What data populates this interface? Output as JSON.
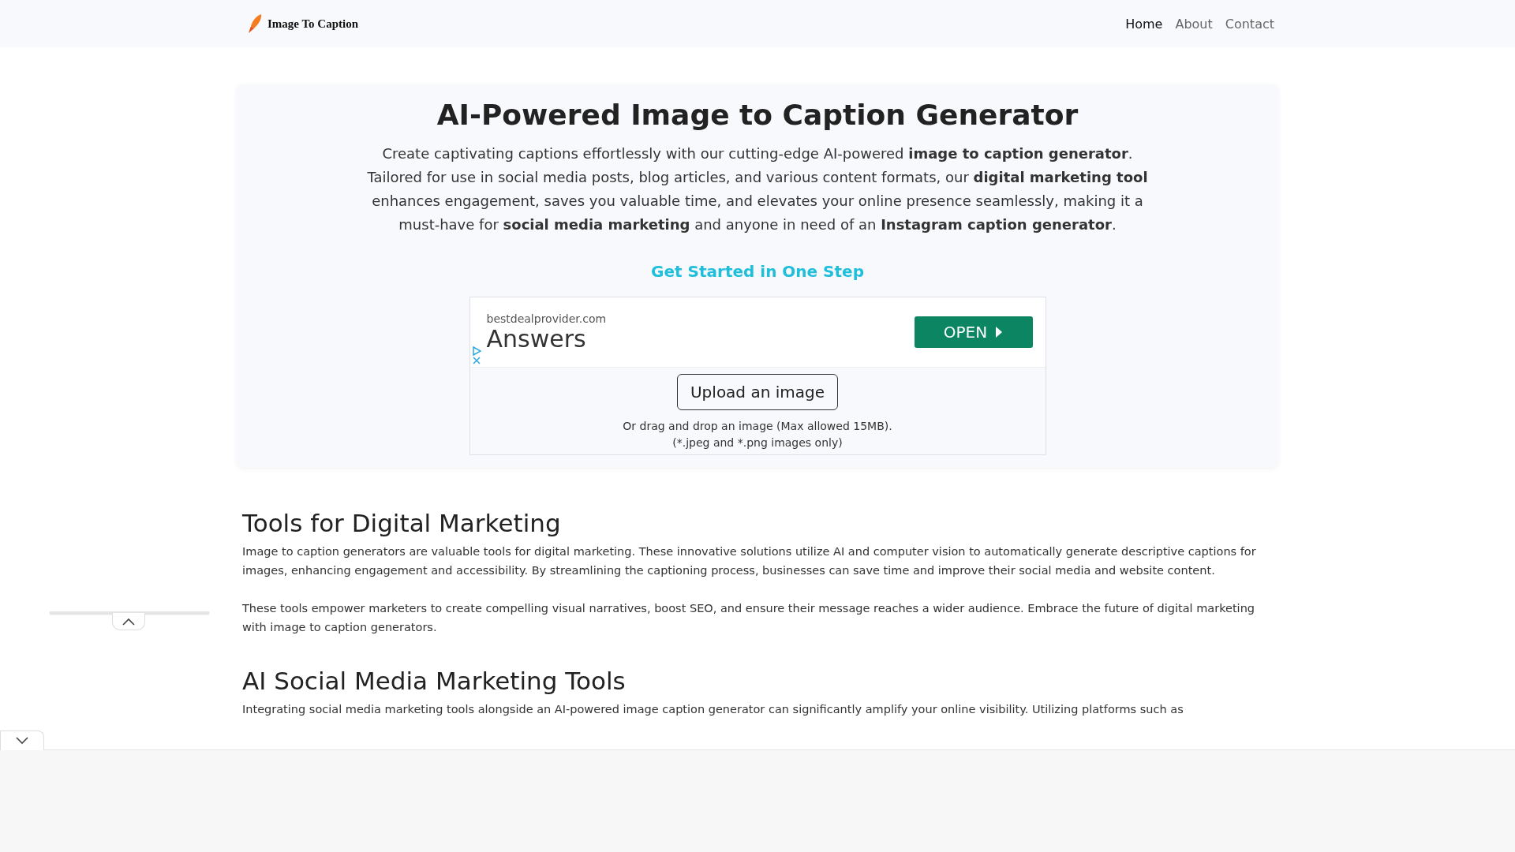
{
  "header": {
    "logo_text": "Image To Caption",
    "nav": [
      {
        "label": "Home",
        "selected": true
      },
      {
        "label": "About",
        "selected": false
      },
      {
        "label": "Contact",
        "selected": false
      }
    ]
  },
  "hero": {
    "title": "AI-Powered Image to Caption Generator",
    "intro": "Create captivating captions effortlessly with our cutting-edge AI-powered **image to caption generator**. Tailored for use in social media posts, blog articles, and various content formats, our **digital marketing tool** enhances engagement, saves you valuable time, and elevates your online presence seamlessly, making it a must-have for **social media marketing** and anyone in need of an **Instagram caption generator**.",
    "cta": "Get Started in One Step"
  },
  "ad": {
    "domain": "bestdealprovider.com",
    "headline": "Answers",
    "button": "OPEN"
  },
  "upload": {
    "button": "Upload an image",
    "hint_lines": [
      "Or drag and drop an image (Max allowed 15MB).",
      "(*.jpeg and *.png images only)"
    ]
  },
  "sections": [
    {
      "heading": "Tools for Digital Marketing",
      "paragraphs": [
        "Image to caption generators are valuable tools for digital marketing. These innovative solutions utilize AI and computer vision to automatically generate descriptive captions for images, enhancing engagement and accessibility. By streamlining the captioning process, businesses can save time and improve their social media and website content.",
        "These tools empower marketers to create compelling visual narratives, boost SEO, and ensure their message reaches a wider audience. Embrace the future of digital marketing with image to caption generators."
      ]
    },
    {
      "heading": "AI Social Media Marketing Tools",
      "paragraphs": [
        "Integrating social media marketing tools alongside an AI-powered image caption generator can significantly amplify your online visibility. Utilizing platforms such as"
      ]
    }
  ]
}
